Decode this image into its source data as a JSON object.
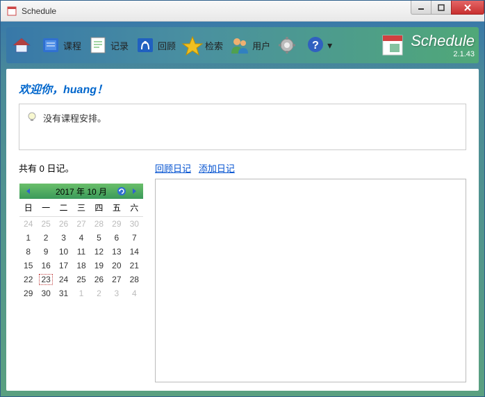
{
  "window": {
    "title": "Schedule"
  },
  "toolbar": {
    "items": [
      {
        "id": "home",
        "label": ""
      },
      {
        "id": "course",
        "label": "课程"
      },
      {
        "id": "record",
        "label": "记录"
      },
      {
        "id": "review",
        "label": "回顾"
      },
      {
        "id": "search",
        "label": "检索"
      },
      {
        "id": "user",
        "label": "用户"
      },
      {
        "id": "settings",
        "label": ""
      },
      {
        "id": "help",
        "label": ""
      }
    ]
  },
  "brand": {
    "name": "Schedule",
    "version": "2.1.43"
  },
  "welcome": {
    "text": "欢迎你，huang！"
  },
  "message": {
    "text": "没有课程安排。"
  },
  "diary": {
    "count_text": "共有 0 日记。",
    "links": {
      "review": "回顾日记",
      "add": "添加日记"
    }
  },
  "calendar": {
    "header": "2017 年 10 月",
    "dow": [
      "日",
      "一",
      "二",
      "三",
      "四",
      "五",
      "六"
    ],
    "weeks": [
      [
        {
          "d": 24,
          "o": true
        },
        {
          "d": 25,
          "o": true
        },
        {
          "d": 26,
          "o": true
        },
        {
          "d": 27,
          "o": true
        },
        {
          "d": 28,
          "o": true
        },
        {
          "d": 29,
          "o": true
        },
        {
          "d": 30,
          "o": true
        }
      ],
      [
        {
          "d": 1
        },
        {
          "d": 2
        },
        {
          "d": 3
        },
        {
          "d": 4
        },
        {
          "d": 5
        },
        {
          "d": 6
        },
        {
          "d": 7
        }
      ],
      [
        {
          "d": 8
        },
        {
          "d": 9
        },
        {
          "d": 10
        },
        {
          "d": 11
        },
        {
          "d": 12
        },
        {
          "d": 13
        },
        {
          "d": 14
        }
      ],
      [
        {
          "d": 15
        },
        {
          "d": 16
        },
        {
          "d": 17
        },
        {
          "d": 18
        },
        {
          "d": 19
        },
        {
          "d": 20
        },
        {
          "d": 21
        }
      ],
      [
        {
          "d": 22
        },
        {
          "d": 23,
          "today": true
        },
        {
          "d": 24
        },
        {
          "d": 25
        },
        {
          "d": 26
        },
        {
          "d": 27
        },
        {
          "d": 28
        }
      ],
      [
        {
          "d": 29
        },
        {
          "d": 30
        },
        {
          "d": 31
        },
        {
          "d": 1,
          "o": true
        },
        {
          "d": 2,
          "o": true
        },
        {
          "d": 3,
          "o": true
        },
        {
          "d": 4,
          "o": true
        }
      ]
    ]
  }
}
